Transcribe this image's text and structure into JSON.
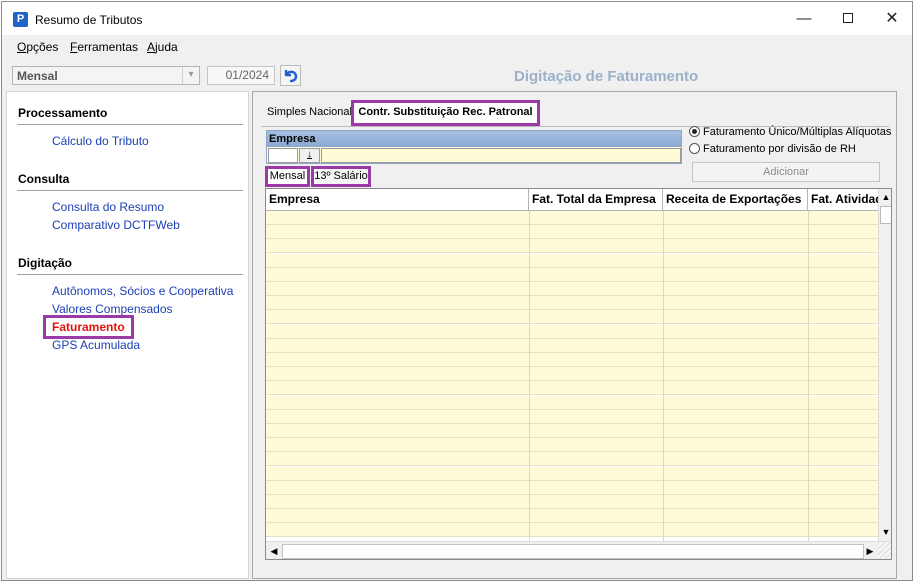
{
  "window": {
    "title": "Resumo de Tributos",
    "app_icon": "P",
    "minimize": "—",
    "close": "✕"
  },
  "menu": [
    {
      "underline": "O",
      "rest": "pções"
    },
    {
      "underline": "F",
      "rest": "erramentas"
    },
    {
      "underline": "A",
      "rest": "juda"
    }
  ],
  "toolbar": {
    "period_type": "Mensal",
    "date": "01/2024",
    "undo_icon": "undo-icon",
    "header_title": "Digitação de Faturamento"
  },
  "nav": {
    "processamento": {
      "title": "Processamento",
      "items": [
        "Cálculo do Tributo"
      ]
    },
    "consulta": {
      "title": "Consulta",
      "items": [
        "Consulta do Resumo",
        "Comparativo DCTFWeb"
      ]
    },
    "digitacao": {
      "title": "Digitação",
      "items": [
        "Autônomos, Sócios e Cooperativa",
        "Valores Compensados",
        "Faturamento",
        "GPS Acumulada"
      ],
      "active": "Faturamento"
    }
  },
  "tabs": {
    "simples": "Simples Nacional",
    "contr": "Contr. Substituição Rec. Patronal"
  },
  "empresa": {
    "label": "Empresa",
    "code": "",
    "name": "",
    "dropdown_icon": "↓"
  },
  "options": {
    "opt1": "Faturamento Único/Múltiplas Alíquotas",
    "opt2": "Faturamento por divisão de RH",
    "selected": "opt1"
  },
  "add_button": "Adicionar",
  "subtabs": {
    "mensal": "Mensal",
    "decimo": "13º Salário"
  },
  "grid": {
    "columns": [
      "Empresa",
      "Fat. Total da Empresa",
      "Receita de Exportações",
      "Fat. Atividade"
    ],
    "row_count": 23
  },
  "colors": {
    "accent_highlight": "#9b3aa6",
    "link": "#1c3fb4",
    "active_link": "#e3140e",
    "row_fill": "#fffbd9"
  }
}
